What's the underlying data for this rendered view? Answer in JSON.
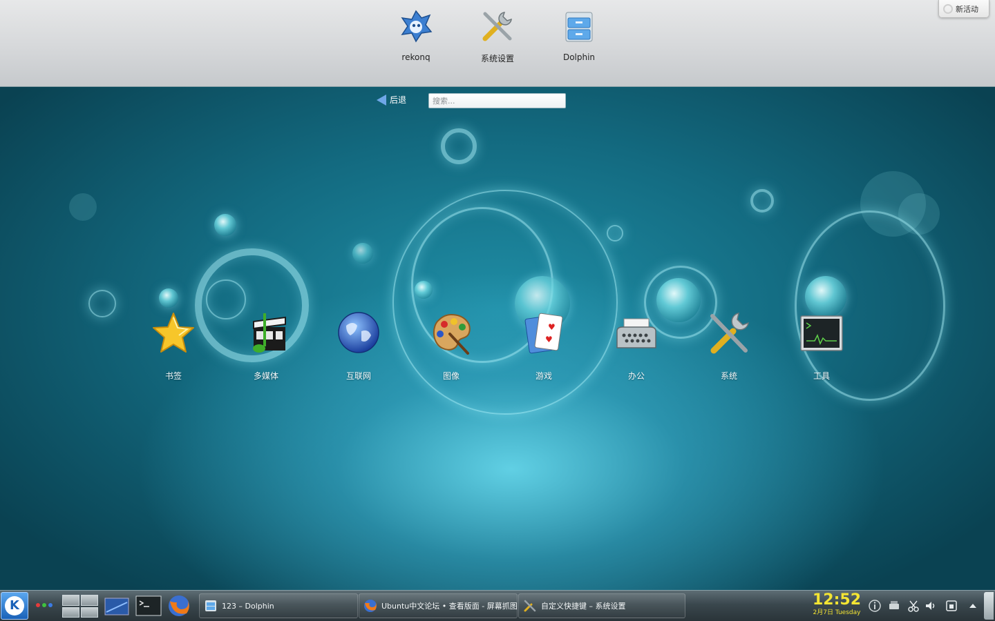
{
  "favorites": [
    {
      "label": "rekonq",
      "icon": "rekonq-icon"
    },
    {
      "label": "系统设置",
      "icon": "system-settings-icon"
    },
    {
      "label": "Dolphin",
      "icon": "dolphin-folder-icon"
    }
  ],
  "new_activity": {
    "label": "新活动",
    "icon": "new-activity-icon"
  },
  "back": {
    "label": "后退",
    "icon": "back-arrow-icon"
  },
  "search": {
    "placeholder": "搜索..."
  },
  "categories": [
    {
      "label": "书签",
      "icon": "bookmark-star-icon"
    },
    {
      "label": "多媒体",
      "icon": "multimedia-icon"
    },
    {
      "label": "互联网",
      "icon": "internet-globe-icon"
    },
    {
      "label": "图像",
      "icon": "graphics-palette-icon"
    },
    {
      "label": "游戏",
      "icon": "games-cards-icon"
    },
    {
      "label": "办公",
      "icon": "office-typewriter-icon"
    },
    {
      "label": "系统",
      "icon": "system-tools-icon"
    },
    {
      "label": "工具",
      "icon": "utilities-terminal-icon"
    }
  ],
  "taskbar": {
    "launcher_icon": "kde-launcher-icon",
    "tasks": [
      {
        "label": "123 – Dolphin",
        "icon": "dolphin-icon"
      },
      {
        "label": "Ubuntu中文论坛 • 查看版面 - 屏幕抓图 -",
        "icon": "firefox-icon"
      },
      {
        "label": "自定义快捷键 – 系统设置",
        "icon": "system-settings-icon"
      }
    ],
    "clock": {
      "time": "12:52",
      "date": "2月7日 Tuesday"
    }
  },
  "colors": {
    "accent": "#f4e533",
    "panel": "#3a474d",
    "desktop": "#136a80"
  }
}
